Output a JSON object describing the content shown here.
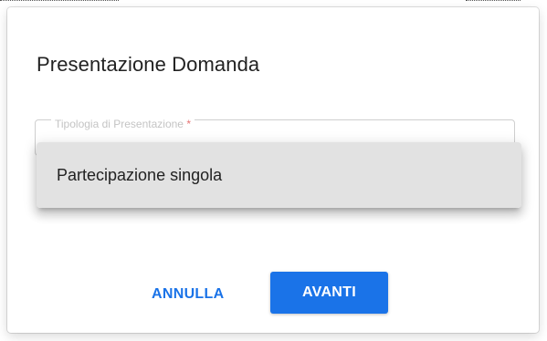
{
  "dialog": {
    "title": "Presentazione Domanda"
  },
  "field": {
    "label": "Tipologia di Presentazione",
    "required_marker": "*"
  },
  "dropdown": {
    "options": [
      {
        "label": "Partecipazione singola",
        "highlighted": true
      }
    ]
  },
  "actions": {
    "cancel_label": "ANNULLA",
    "next_label": "AVANTI"
  },
  "colors": {
    "accent": "#1a73e8",
    "option_highlight": "#e2e2e2",
    "required": "#e57373"
  }
}
